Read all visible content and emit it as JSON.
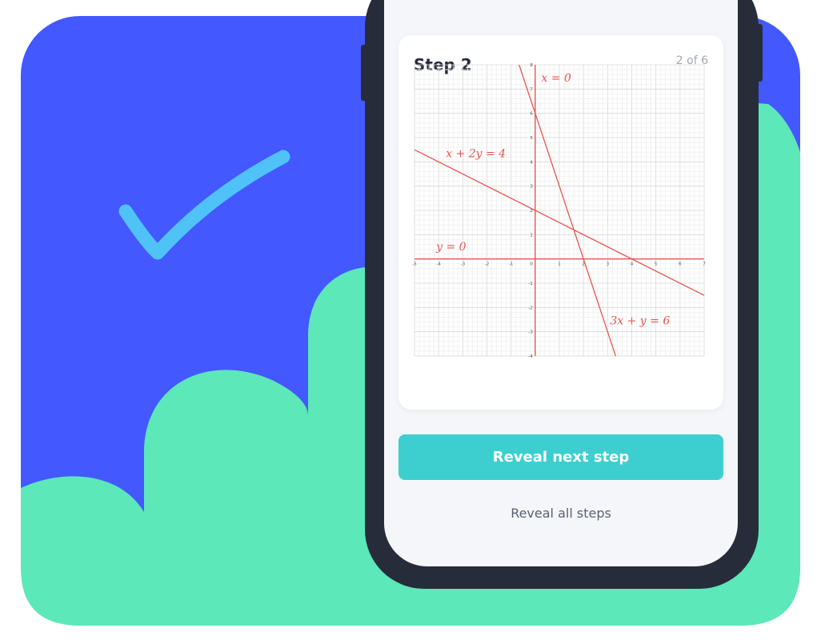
{
  "colors": {
    "blue_panel": "#4458ff",
    "mint_cloud": "#5ce8b8",
    "check_mark": "#4fc3f7",
    "phone_frame": "#272c3b",
    "graph_red": "#e8554e",
    "button_teal": "#3dcfcf"
  },
  "decoration": {
    "check_icon": "check-mark-icon"
  },
  "card": {
    "title": "Step 2",
    "step_counter": "2 of 6"
  },
  "chart_data": {
    "type": "line",
    "title": "",
    "xlabel": "",
    "ylabel": "",
    "xlim": [
      -5,
      7
    ],
    "ylim": [
      -4,
      8
    ],
    "x_ticks": [
      -5,
      -4,
      -3,
      -2,
      -1,
      1,
      2,
      3,
      4,
      5,
      6,
      7
    ],
    "y_ticks": [
      -4,
      -3,
      -2,
      -1,
      1,
      2,
      3,
      4,
      5,
      6,
      7,
      8
    ],
    "origin_label": "0",
    "grid": true,
    "series": [
      {
        "name": "x + 2y = 4",
        "x": [
          -5,
          7
        ],
        "y": [
          4.5,
          -1.5
        ]
      },
      {
        "name": "3x + y = 6",
        "x": [
          -0.667,
          3.333
        ],
        "y": [
          8,
          -4
        ]
      },
      {
        "name": "x = 0",
        "x": [
          0,
          0
        ],
        "y": [
          -4,
          8
        ]
      },
      {
        "name": "y = 0",
        "x": [
          -5,
          7
        ],
        "y": [
          0,
          0
        ]
      }
    ]
  },
  "actions": {
    "reveal_next": "Reveal next step",
    "reveal_all": "Reveal all steps"
  }
}
